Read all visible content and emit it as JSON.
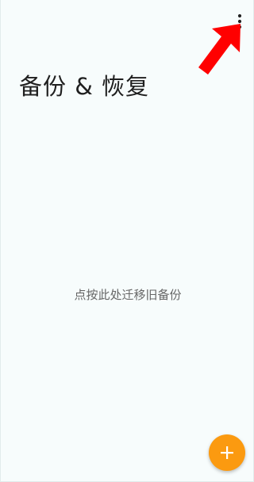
{
  "toolbar": {
    "overflow_icon": "more-vert-icon"
  },
  "annotation": {
    "arrow_color": "#ff0000",
    "arrow_icon": "pointer-arrow"
  },
  "page": {
    "title": "备份 & 恢复"
  },
  "content": {
    "empty_action_label": "点按此处迁移旧备份"
  },
  "fab": {
    "icon": "plus-icon",
    "color": "#fb9a10"
  },
  "theme": {
    "background": "#f7fcfc",
    "title_color": "#1f1f1f",
    "secondary_text": "#666666"
  }
}
